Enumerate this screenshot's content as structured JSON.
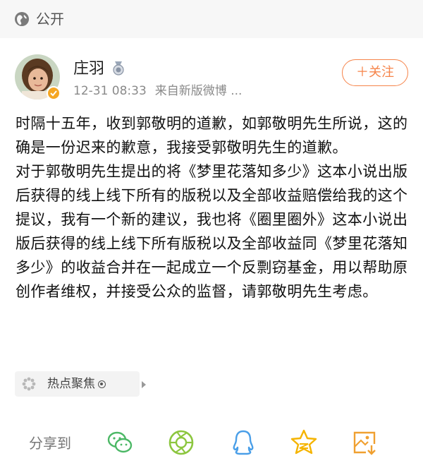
{
  "header": {
    "visibility_label": "公开",
    "visibility_icon": "globe-icon"
  },
  "author": {
    "name": "庄羽",
    "badge_icon": "medal-icon",
    "verified_icon": "verified-badge-icon",
    "time": "12-31 08:33",
    "source": "来自新版微博 ..."
  },
  "follow_button": {
    "label": "＋关注",
    "color": "#f6844a"
  },
  "post": {
    "paragraphs": [
      "时隔十五年，收到郭敬明的道歉，如郭敬明先生所说，这的确是一份迟来的歉意，我接受郭敬明先生的道歉。",
      "对于郭敬明先生提出的将《梦里花落知多少》这本小说出版后获得的线上线下所有的版税以及全部收益赔偿给我的这个提议，我有一个新的建议，我也将《圈里圈外》这本小说出版后获得的线上线下所有版税以及全部收益同《梦里花落知多少》的收益合并在一起成立一个反剽窃基金，用以帮助原创作者维权，并接受公众的监督，请郭敬明先生考虑。"
    ]
  },
  "topic_tag": {
    "label": "热点聚焦",
    "icon": "flower-icon"
  },
  "share": {
    "label": "分享到",
    "targets": [
      {
        "name": "wechat",
        "icon": "wechat-icon",
        "color": "#4cb866"
      },
      {
        "name": "moments",
        "icon": "moments-icon",
        "color": "#8cc63f"
      },
      {
        "name": "qq",
        "icon": "qq-icon",
        "color": "#4a9fe8"
      },
      {
        "name": "qzone",
        "icon": "qzone-star-icon",
        "color": "#f5b400"
      },
      {
        "name": "save-image",
        "icon": "save-image-icon",
        "color": "#f0a030"
      }
    ]
  }
}
